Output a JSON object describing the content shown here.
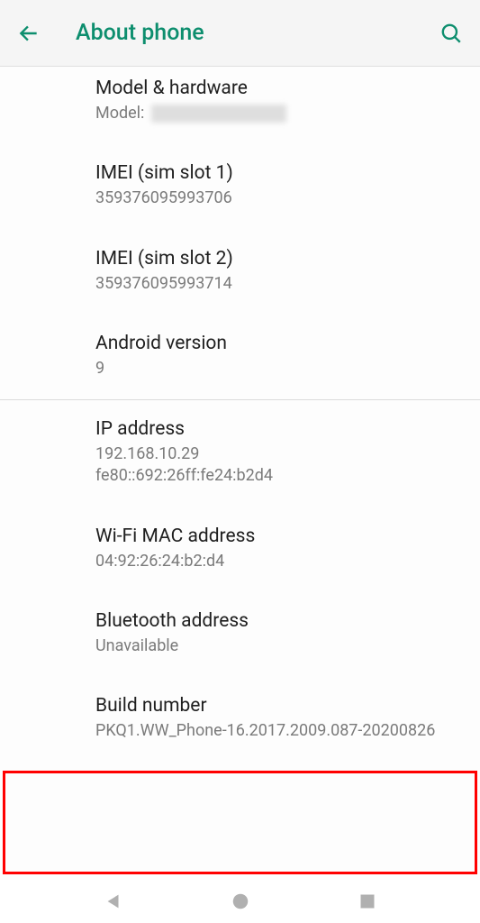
{
  "header": {
    "title": "About phone"
  },
  "items": {
    "model": {
      "title": "Model & hardware",
      "label": "Model:"
    },
    "imei1": {
      "title": "IMEI (sim slot 1)",
      "value": "359376095993706"
    },
    "imei2": {
      "title": "IMEI (sim slot 2)",
      "value": "359376095993714"
    },
    "android": {
      "title": "Android version",
      "value": "9"
    },
    "ip": {
      "title": "IP address",
      "value1": "192.168.10.29",
      "value2": "fe80::692:26ff:fe24:b2d4"
    },
    "wifi": {
      "title": "Wi-Fi MAC address",
      "value": "04:92:26:24:b2:d4"
    },
    "bluetooth": {
      "title": "Bluetooth address",
      "value": "Unavailable"
    },
    "build": {
      "title": "Build number",
      "value": "PKQ1.WW_Phone-16.2017.2009.087-20200826"
    }
  }
}
